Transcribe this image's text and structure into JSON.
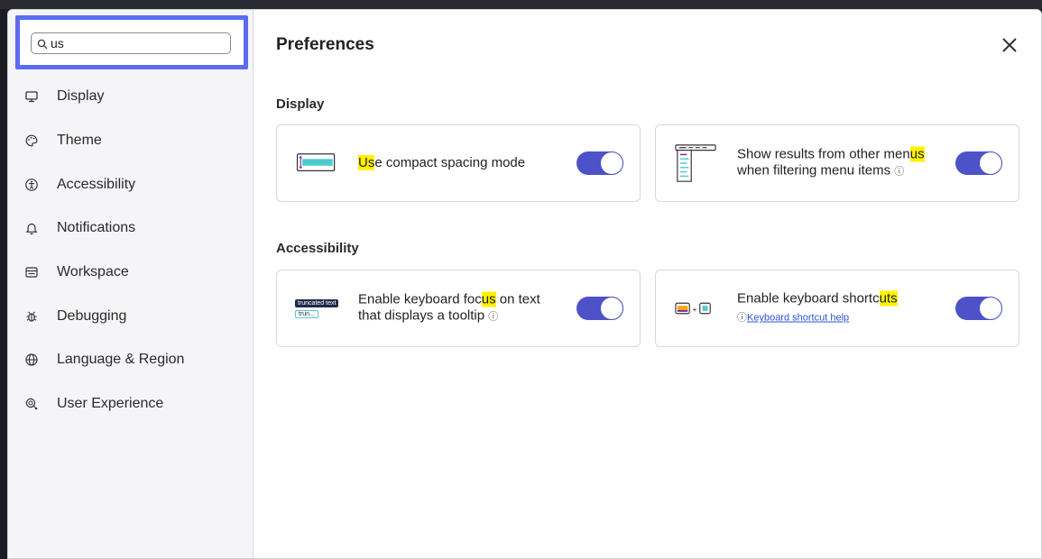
{
  "search": {
    "value": "us",
    "placeholder": ""
  },
  "sidebar": {
    "items": [
      {
        "label": "Display",
        "icon": "monitor-icon"
      },
      {
        "label": "Theme",
        "icon": "palette-icon"
      },
      {
        "label": "Accessibility",
        "icon": "accessibility-icon"
      },
      {
        "label": "Notifications",
        "icon": "bell-icon"
      },
      {
        "label": "Workspace",
        "icon": "workspace-icon"
      },
      {
        "label": "Debugging",
        "icon": "bug-icon"
      },
      {
        "label": "Language & Region",
        "icon": "globe-icon"
      },
      {
        "label": "User Experience",
        "icon": "user-experience-icon"
      }
    ]
  },
  "main": {
    "title": "Preferences",
    "close_icon": "close-icon",
    "sections": {
      "display": {
        "title": "Display",
        "card1": {
          "hl": "Us",
          "rest": "e compact spacing mode",
          "toggle_on": true
        },
        "card2": {
          "pre": "Show results from other men",
          "hl": "us",
          "post": " when filtering menu items",
          "info": "ⓘ",
          "toggle_on": true
        }
      },
      "accessibility": {
        "title": "Accessibility",
        "card1": {
          "pre": "Enable keyboard foc",
          "hl": "us",
          "post": " on text that displays a tooltip",
          "info": "ⓘ",
          "illus_top": "truncated text",
          "illus_bottom": "trun...",
          "toggle_on": true
        },
        "card2": {
          "pre": "Enable keyboard shortc",
          "hl": "uts",
          "info": "ⓘ",
          "link": "Keyboard shortcut help",
          "toggle_on": true
        }
      }
    }
  },
  "colors": {
    "accent": "#4e52c8",
    "focus_ring": "#5b6cf0",
    "highlight": "#fff200",
    "illus_teal": "#4fc9d0",
    "illus_purple": "#7a2a8c"
  }
}
